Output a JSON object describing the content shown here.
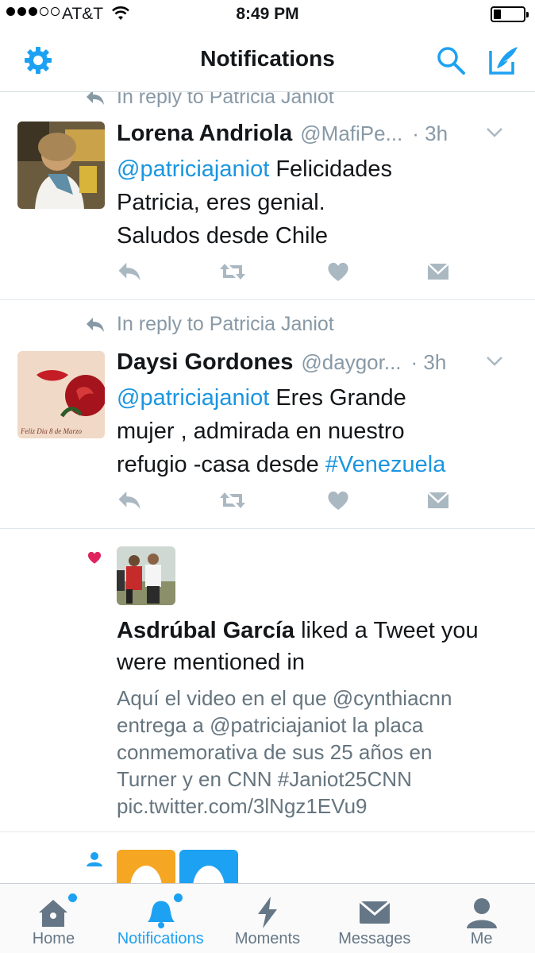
{
  "status_bar": {
    "carrier": "AT&T",
    "time": "8:49 PM",
    "battery_level": 0.25
  },
  "nav": {
    "title": "Notifications",
    "left_icon": "gear-icon",
    "right_icons": [
      "search-icon",
      "compose-icon"
    ]
  },
  "feed": {
    "partial_reply": "In reply to Patricia Janiot",
    "tweets": [
      {
        "reply_to": "In reply to Patricia Janiot",
        "name": "Lorena Andriola",
        "handle": "@MafiPe...",
        "time": "· 3h",
        "mention": "@patriciajaniot",
        "text_lines": [
          " Felicidades",
          "Patricia, eres genial.",
          "Saludos desde Chile"
        ]
      },
      {
        "reply_to": "In reply to Patricia Janiot",
        "name": "Daysi Gordones",
        "handle": "@daygor...",
        "time": "· 3h",
        "mention": "@patriciajaniot",
        "text_line1_rest": " Eres Grande",
        "text_line2": "mujer , admirada en nuestro",
        "text_line3_pre": "refugio -casa desde ",
        "hashtag": "#Venezuela"
      }
    ],
    "activity": {
      "name": "Asdrúbal García",
      "action": " liked a Tweet you were mentioned in",
      "quote_lines": [
        "Aquí el video en el que @cynthiacnn",
        "entrega a @patriciajaniot la placa",
        "conmemorativa de sus 25 años en",
        "Turner y en CNN #Janiot25CNN",
        "pic.twitter.com/3lNgz1EVu9"
      ]
    }
  },
  "tabs": [
    {
      "label": "Home",
      "icon": "home-icon",
      "active": false
    },
    {
      "label": "Notifications",
      "icon": "bell-icon",
      "active": true
    },
    {
      "label": "Moments",
      "icon": "lightning-icon",
      "active": false
    },
    {
      "label": "Messages",
      "icon": "envelope-icon",
      "active": false
    },
    {
      "label": "Me",
      "icon": "person-icon",
      "active": false
    }
  ],
  "colors": {
    "accent": "#1da1f2",
    "link": "#1b95e0",
    "muted": "#8899a6",
    "like": "#e0245e"
  }
}
